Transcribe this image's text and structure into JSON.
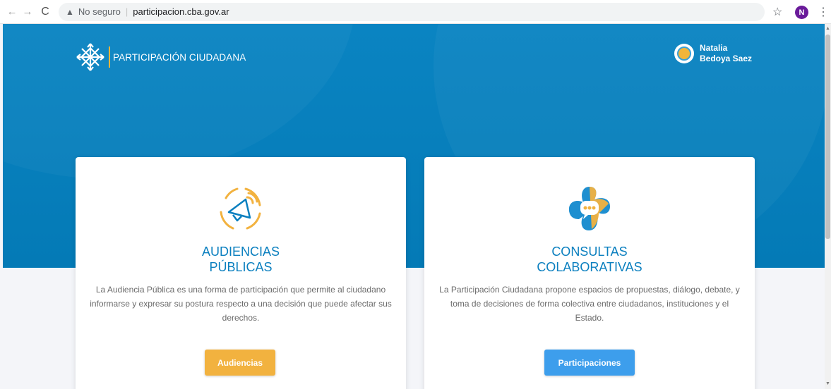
{
  "browser": {
    "secure_label": "No seguro",
    "separator": "|",
    "url": "participacion.cba.gov.ar",
    "profile_initial": "N",
    "icons": {
      "back": "back-arrow-icon",
      "forward": "forward-arrow-icon",
      "reload": "reload-icon",
      "warning": "warning-icon",
      "star": "bookmark-star-icon",
      "menu": "kebab-menu-icon"
    }
  },
  "header": {
    "brand_text": "PARTICIPACIÓN CIUDADANA",
    "user_first": "Natalia",
    "user_last": "Bedoya Saez"
  },
  "cards": [
    {
      "title_line1": "AUDIENCIAS",
      "title_line2": "PÚBLICAS",
      "description": "La Audiencia Pública es una forma de participación que permite al ciudadano informarse y expresar su postura respecto a una decisión que puede afectar sus derechos.",
      "button": "Audiencias",
      "icon": "megaphone-icon"
    },
    {
      "title_line1": "CONSULTAS",
      "title_line2": "COLABORATIVAS",
      "description": "La Participación Ciudadana propone espacios de propuestas, diálogo, debate, y toma de decisiones de forma colectiva entre ciudadanos, instituciones y el Estado.",
      "button": "Participaciones",
      "icon": "chat-bubble-icon"
    }
  ],
  "colors": {
    "hero_blue": "#0a84c2",
    "title_blue": "#0a7fbf",
    "accent_orange": "#f2b23f",
    "button_blue": "#3d9eec"
  }
}
